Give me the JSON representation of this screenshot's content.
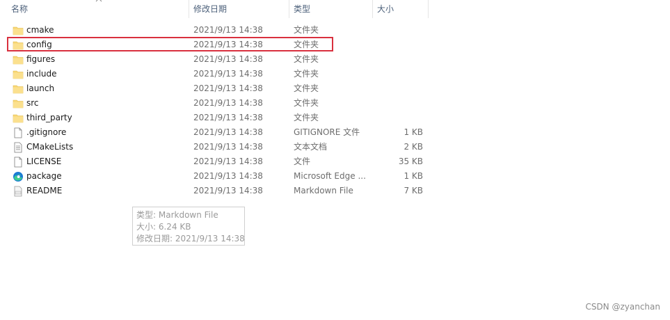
{
  "columns": {
    "name": "名称",
    "date": "修改日期",
    "type": "类型",
    "size": "大小"
  },
  "files": [
    {
      "name": "cmake",
      "date": "2021/9/13 14:38",
      "type": "文件夹",
      "size": "",
      "icon": "folder-icon"
    },
    {
      "name": "config",
      "date": "2021/9/13 14:38",
      "type": "文件夹",
      "size": "",
      "icon": "folder-icon"
    },
    {
      "name": "figures",
      "date": "2021/9/13 14:38",
      "type": "文件夹",
      "size": "",
      "icon": "folder-icon"
    },
    {
      "name": "include",
      "date": "2021/9/13 14:38",
      "type": "文件夹",
      "size": "",
      "icon": "folder-icon"
    },
    {
      "name": "launch",
      "date": "2021/9/13 14:38",
      "type": "文件夹",
      "size": "",
      "icon": "folder-icon"
    },
    {
      "name": "src",
      "date": "2021/9/13 14:38",
      "type": "文件夹",
      "size": "",
      "icon": "folder-icon"
    },
    {
      "name": "third_party",
      "date": "2021/9/13 14:38",
      "type": "文件夹",
      "size": "",
      "icon": "folder-icon"
    },
    {
      "name": ".gitignore",
      "date": "2021/9/13 14:38",
      "type": "GITIGNORE 文件",
      "size": "1 KB",
      "icon": "blank-file-icon"
    },
    {
      "name": "CMakeLists",
      "date": "2021/9/13 14:38",
      "type": "文本文档",
      "size": "2 KB",
      "icon": "text-file-icon"
    },
    {
      "name": "LICENSE",
      "date": "2021/9/13 14:38",
      "type": "文件",
      "size": "35 KB",
      "icon": "blank-file-icon"
    },
    {
      "name": "package",
      "date": "2021/9/13 14:38",
      "type": "Microsoft Edge ...",
      "size": "1 KB",
      "icon": "edge-icon"
    },
    {
      "name": "README",
      "date": "2021/9/13 14:38",
      "type": "Markdown File",
      "size": "7 KB",
      "icon": "markdown-file-icon"
    }
  ],
  "tooltip": {
    "type_line": "类型: Markdown File",
    "size_line": "大小: 6.24 KB",
    "date_line": "修改日期: 2021/9/13 14:38"
  },
  "watermark": "CSDN @zyanchan",
  "colors": {
    "folder": "#f8d775",
    "highlight": "#d9303e",
    "edge_blue": "#1b7bd4",
    "edge_green": "#3ccf8e"
  }
}
